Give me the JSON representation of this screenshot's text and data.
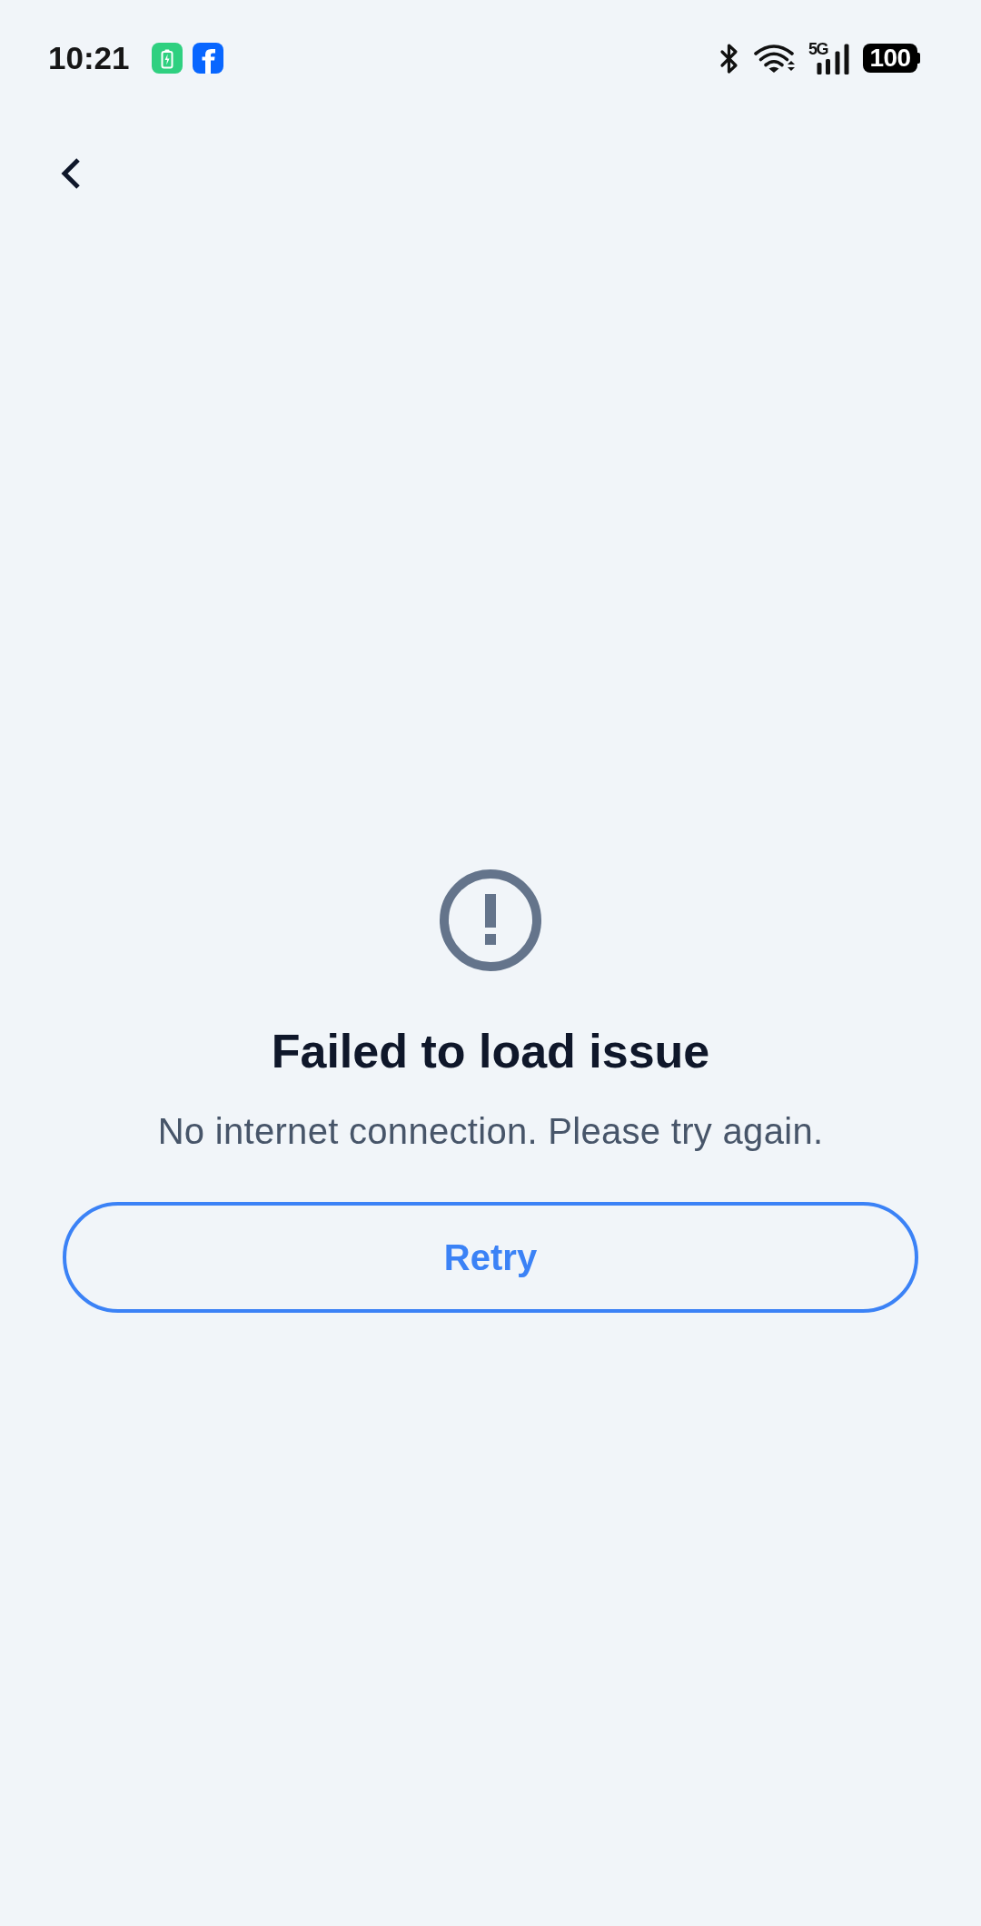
{
  "status_bar": {
    "time": "10:21",
    "network_type": "5G",
    "battery": "100"
  },
  "error": {
    "title": "Failed to load issue",
    "message": "No internet connection. Please try again."
  },
  "retry_button": {
    "label": "Retry"
  }
}
